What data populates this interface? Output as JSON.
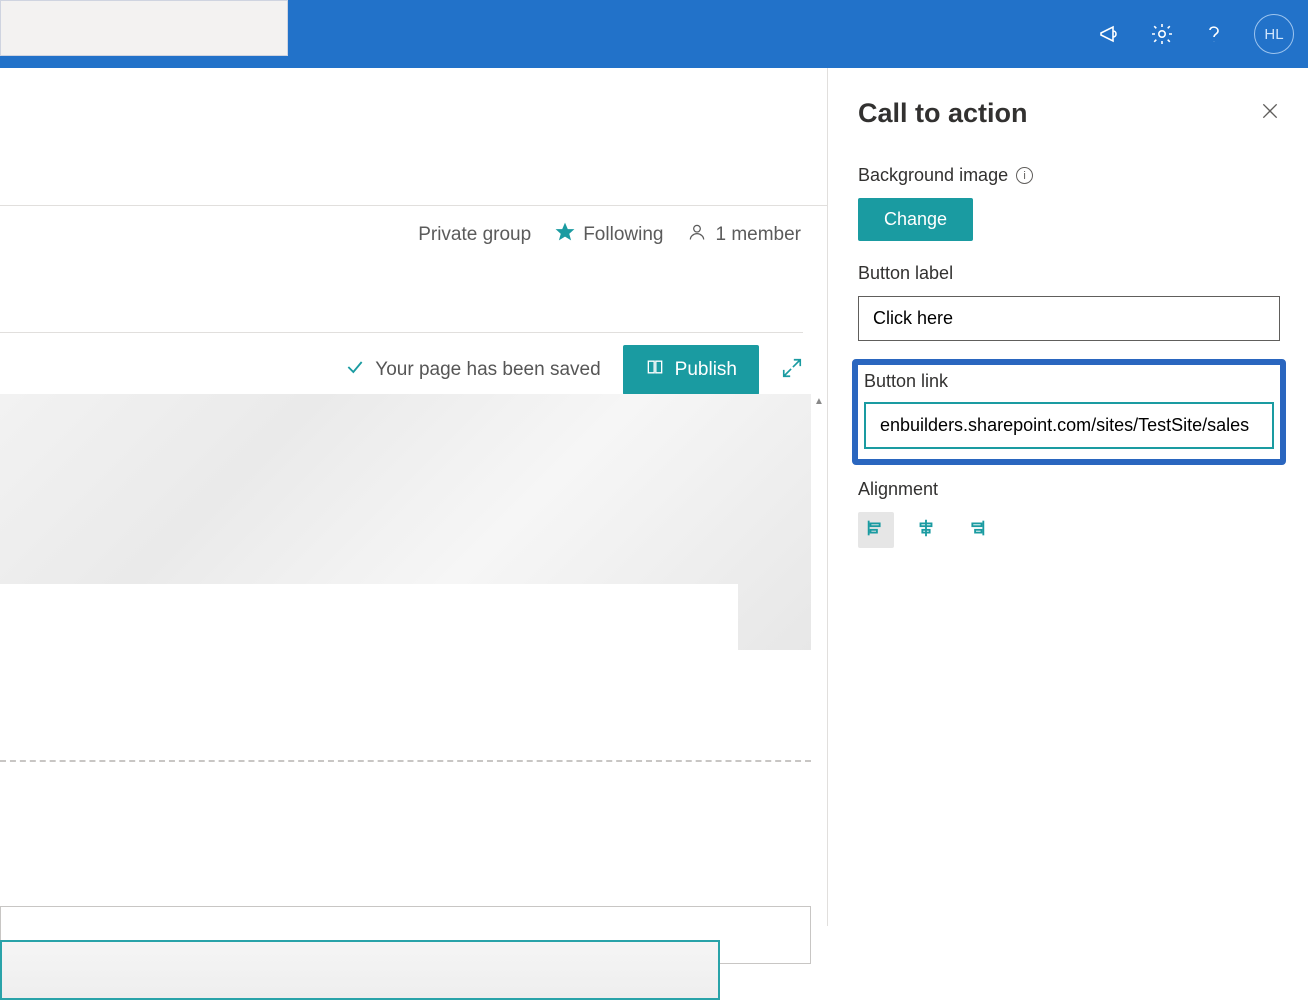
{
  "topbar": {
    "avatar_initials": "HL"
  },
  "info_bar": {
    "group_type": "Private group",
    "following_label": "Following",
    "members_label": "1 member"
  },
  "status": {
    "saved_message": "Your page has been saved",
    "publish_label": "Publish"
  },
  "panel": {
    "title": "Call to action",
    "bg_image_label": "Background image",
    "change_label": "Change",
    "button_label_label": "Button label",
    "button_label_value": "Click here",
    "button_link_label": "Button link",
    "button_link_value": "enbuilders.sharepoint.com/sites/TestSite/sales",
    "alignment_label": "Alignment"
  }
}
